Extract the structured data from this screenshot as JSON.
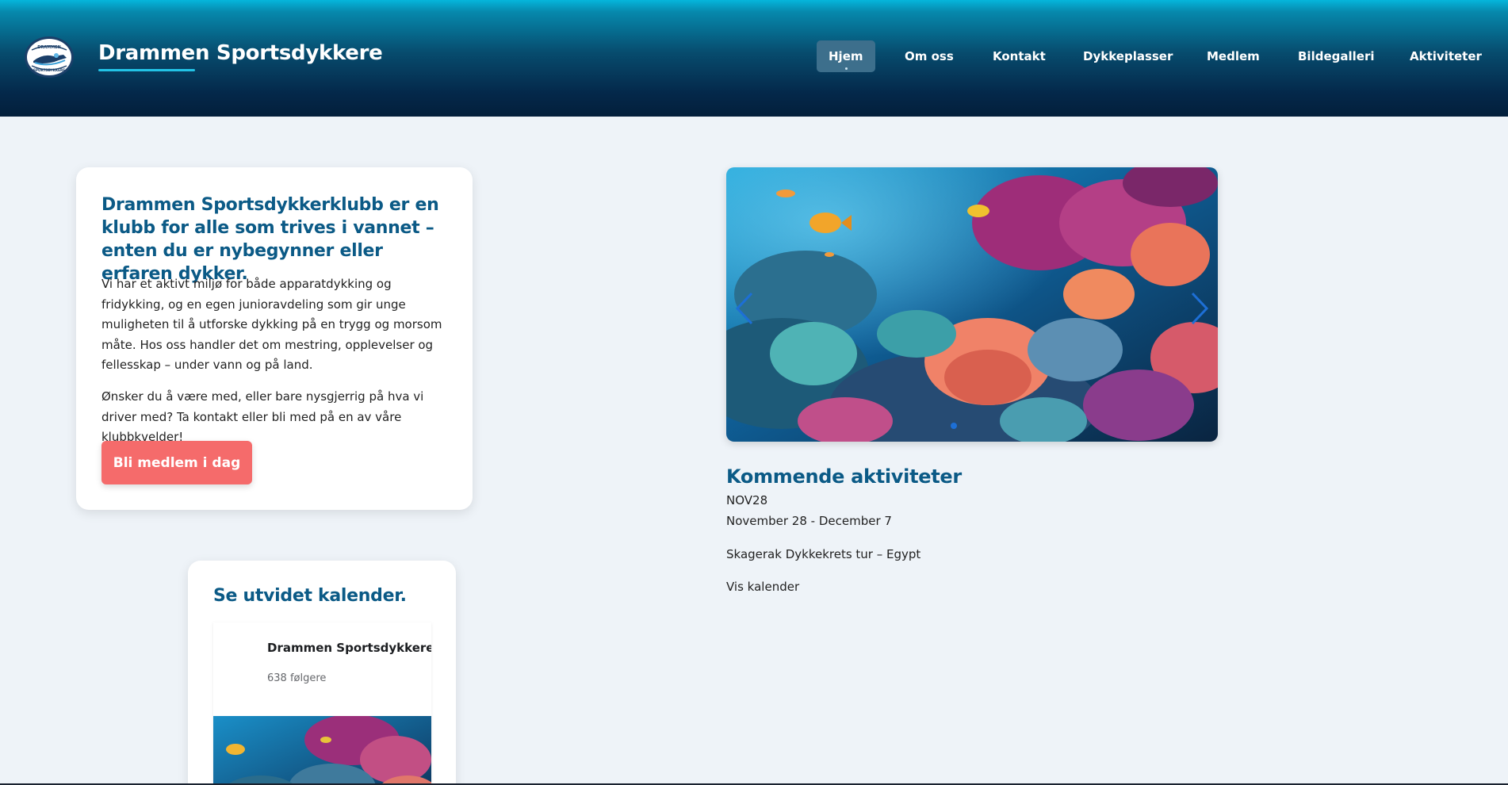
{
  "header": {
    "site_title": "Drammen Sportsdykkere",
    "logo_text_top": "DRAMMEN",
    "logo_text_bottom": "SPORTSDYKKERE",
    "nav": [
      {
        "label": "Hjem",
        "active": true
      },
      {
        "label": "Om oss"
      },
      {
        "label": "Kontakt"
      },
      {
        "label": "Dykkeplasser"
      },
      {
        "label": "Medlem"
      },
      {
        "label": "Bildegalleri"
      },
      {
        "label": "Aktiviteter"
      }
    ]
  },
  "intro": {
    "heading": "Drammen Sportsdykkerklubb er en klubb for alle som trives i vannet – enten du er nybegynner eller erfaren dykker.",
    "paragraph1": "Vi har et aktivt miljø for både apparatdykking og fridykking, og en egen junioravdeling som gir unge muligheten til å utforske dykking på en trygg og morsom måte. Hos oss handler det om mestring, opplevelser og fellesskap – under vann og på land.",
    "paragraph2": "Ønsker du å være med, eller bare nysgjerrig på hva vi driver med? Ta kontakt eller bli med på en av våre klubbkvelder!",
    "cta_label": "Bli medlem i dag"
  },
  "calendar": {
    "heading": "Se utvidet kalender.",
    "page_name": "Drammen Sportsdykkere",
    "followers": "638 følgere"
  },
  "slider": {
    "image_icon": "coral-reef-photo",
    "prev_icon": "chevron-left-icon",
    "next_icon": "chevron-right-icon"
  },
  "activities": {
    "heading": "Kommende aktiviteter",
    "date_short": "NOV28",
    "date_range": "November 28 - December 7",
    "title": "Skagerak Dykkekrets tur – Egypt",
    "link_label": "Vis kalender"
  },
  "colors": {
    "accent_heading": "#0b5a86",
    "cta": "#f56b6b",
    "header_dark": "#031f3b",
    "header_light": "#05b6dc",
    "page_bg": "#eef3f8"
  }
}
